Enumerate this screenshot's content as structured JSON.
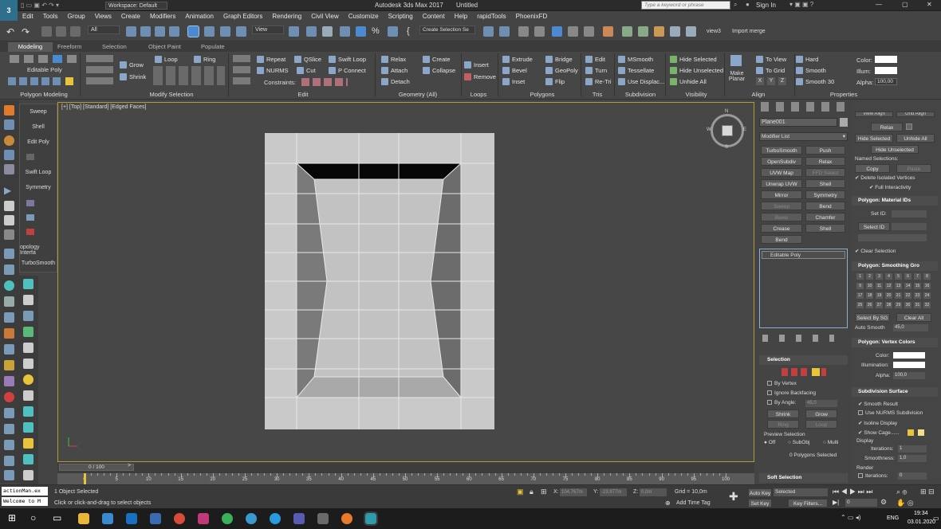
{
  "titlebar": {
    "workspace": "Workspace: Default",
    "title": "Autodesk 3ds Max 2017",
    "filename": "Untitled",
    "search_placeholder": "Type a keyword or phrase",
    "signin": "Sign In"
  },
  "menu": [
    "Edit",
    "Tools",
    "Group",
    "Views",
    "Create",
    "Modifiers",
    "Animation",
    "Graph Editors",
    "Rendering",
    "Civil View",
    "Customize",
    "Scripting",
    "Content",
    "Help",
    "rapidTools",
    "PhoenixFD"
  ],
  "toolbar": {
    "filter": "All",
    "refcoord": "View",
    "selset": "Create Selection Se",
    "view3": "view3",
    "import_merge": "Import merge"
  },
  "ribbon_tabs": [
    "Modeling",
    "Freeform",
    "Selection",
    "Object Paint",
    "Populate"
  ],
  "ribbon": {
    "edit_poly": "Editable Poly",
    "grow": "Grow",
    "shrink": "Shrink",
    "loop": "Loop",
    "ring": "Ring",
    "repeat": "Repeat",
    "qslice": "QSlice",
    "swift_loop": "Swift Loop",
    "nurms": "NURMS",
    "cut": "Cut",
    "p_connect": "P Connect",
    "constraints": "Constraints:",
    "relax": "Relax",
    "create": "Create",
    "attach": "Attach",
    "collapse": "Collapse",
    "detach": "Detach",
    "insert": "Insert",
    "remove": "Remove",
    "extrude": "Extrude",
    "bridge": "Bridge",
    "bevel": "Bevel",
    "geopoly": "GeoPoly",
    "inset": "Inset",
    "flip": "Flip",
    "edit": "Edit",
    "turn": "Turn",
    "retri": "Re-Tri",
    "msmooth": "MSmooth",
    "tessellate": "Tessellate",
    "use_displac": "Use Displac...",
    "hide_selected": "Hide Selected",
    "hide_unselected": "Hide Unselected",
    "unhide_all": "Unhide All",
    "make_planar": "Make Planar",
    "to_view": "To View",
    "to_grid": "To Grid",
    "xyz": [
      "X",
      "Y",
      "Z"
    ],
    "hard": "Hard",
    "smooth": "Smooth",
    "smooth30": "Smooth 30",
    "color": "Color:",
    "illum": "Illum:",
    "alpha": "Alpha:",
    "alpha_val": "100,00",
    "footers": [
      "Polygon Modeling",
      "Modify Selection",
      "Edit",
      "Geometry (All)",
      "Loops",
      "Polygons",
      "Tris",
      "Subdivision",
      "Visibility",
      "Align",
      "Properties"
    ]
  },
  "flyout": [
    "Sweep",
    "Shell",
    "Edit Poly",
    "Swift Loop",
    "Symmetry",
    "opology Interfa",
    "TurboSmooth"
  ],
  "viewport": {
    "label": "[+] [Top] [Standard] [Edged Faces]",
    "viewcube": {
      "n": "N",
      "s": "S",
      "e": "E",
      "w": "W"
    }
  },
  "cmdpanel": {
    "object_name": "Plane001",
    "modifier_list": "Modifier List",
    "mod_buttons": [
      "TurboSmooth",
      "Push",
      "OpenSubdiv",
      "Relax",
      "UVW Map",
      "FFD Select",
      "Unwrap UVW",
      "Shell",
      "Mirror",
      "Symmetry",
      "Sweep",
      "Bend",
      "Bevel",
      "Chamfer",
      "Crease",
      "Shell",
      "Bend"
    ],
    "stack_item": "Editable Poly",
    "selection_title": "Selection",
    "by_vertex": "By Vertex",
    "ignore_backfacing": "Ignore Backfacing",
    "by_angle": "By Angle:",
    "by_angle_val": "45,0",
    "shrink": "Shrink",
    "grow": "Grow",
    "ring": "Ring",
    "loop": "Loop",
    "preview_selection": "Preview Selection",
    "off": "Off",
    "subobj": "SubObj",
    "multi": "Multi",
    "poly_selected": "0 Polygons Selected",
    "soft_selection": "Soft Selection"
  },
  "rightpanel": {
    "view_align": "View Align",
    "grid_align": "Grid Align",
    "relax": "Relax",
    "hide_selected": "Hide Selected",
    "unhide_all": "Unhide All",
    "hide_unselected": "Hide Unselected",
    "named_selections": "Named Selections:",
    "copy": "Copy",
    "paste": "Paste",
    "delete_isolated": "Delete Isolated Vertices",
    "full_interactivity": "Full Interactivity",
    "matids_title": "Polygon: Material IDs",
    "set_id": "Set ID:",
    "select_id": "Select ID",
    "clear_selection": "Clear Selection",
    "smoothing_title": "Polygon: Smoothing Gro",
    "smoothing_groups": [
      "1",
      "2",
      "3",
      "4",
      "5",
      "6",
      "7",
      "8",
      "9",
      "10",
      "11",
      "12",
      "13",
      "14",
      "15",
      "16",
      "17",
      "18",
      "19",
      "20",
      "21",
      "22",
      "23",
      "24",
      "25",
      "26",
      "27",
      "28",
      "29",
      "30",
      "31",
      "32"
    ],
    "select_by_sg": "Select By SG",
    "clear_all": "Clear All",
    "auto_smooth": "Auto Smooth",
    "auto_smooth_val": "45,0",
    "vertex_colors_title": "Polygon: Vertex Colors",
    "color": "Color:",
    "illumination": "Illumination:",
    "alpha": "Alpha:",
    "alpha_val": "100,0",
    "subdiv_title": "Subdivision Surface",
    "smooth_result": "Smooth Result",
    "use_nurms": "Use NURMS Subdivision",
    "isoline": "Isoline Display",
    "show_cage": "Show Cage......",
    "display": "Display",
    "iterations": "Iterations:",
    "iter_val": "1",
    "smoothness": "Smoothness:",
    "smooth_val": "1,0",
    "render": "Render",
    "render_iter": "Iterations:",
    "render_iter_val": "0"
  },
  "timeline": {
    "frame": "0 / 100",
    "ticks": [
      "0",
      "5",
      "10",
      "15",
      "20",
      "25",
      "30",
      "35",
      "40",
      "45",
      "50",
      "55",
      "60",
      "65",
      "70",
      "75",
      "80",
      "85",
      "90",
      "95",
      "100"
    ]
  },
  "status": {
    "maxscript": "actionMan.ex",
    "welcome": "Welcome to M",
    "objects_selected": "1 Object Selected",
    "prompt": "Click or click-and-drag to select objects",
    "x_label": "X:",
    "x_val": "104,767m",
    "y_label": "Y:",
    "y_val": "-23,977m",
    "z_label": "Z:",
    "z_val": "0,0m",
    "grid": "Grid = 10,0m",
    "add_time_tag": "Add Time Tag",
    "auto_key": "Auto Key",
    "set_key": "Set Key",
    "selected": "Selected",
    "key_filters": "Key Filters...",
    "frame_val": "0"
  },
  "taskbar": {
    "lang": "ENG",
    "time": "19:34",
    "date": "03.01.2020"
  },
  "colors": {
    "viewport_bg": "#474747",
    "plane_fill": "#c8c8c8",
    "highlight": "#b79a2e",
    "swatch_yellow": "#e8c43a"
  }
}
